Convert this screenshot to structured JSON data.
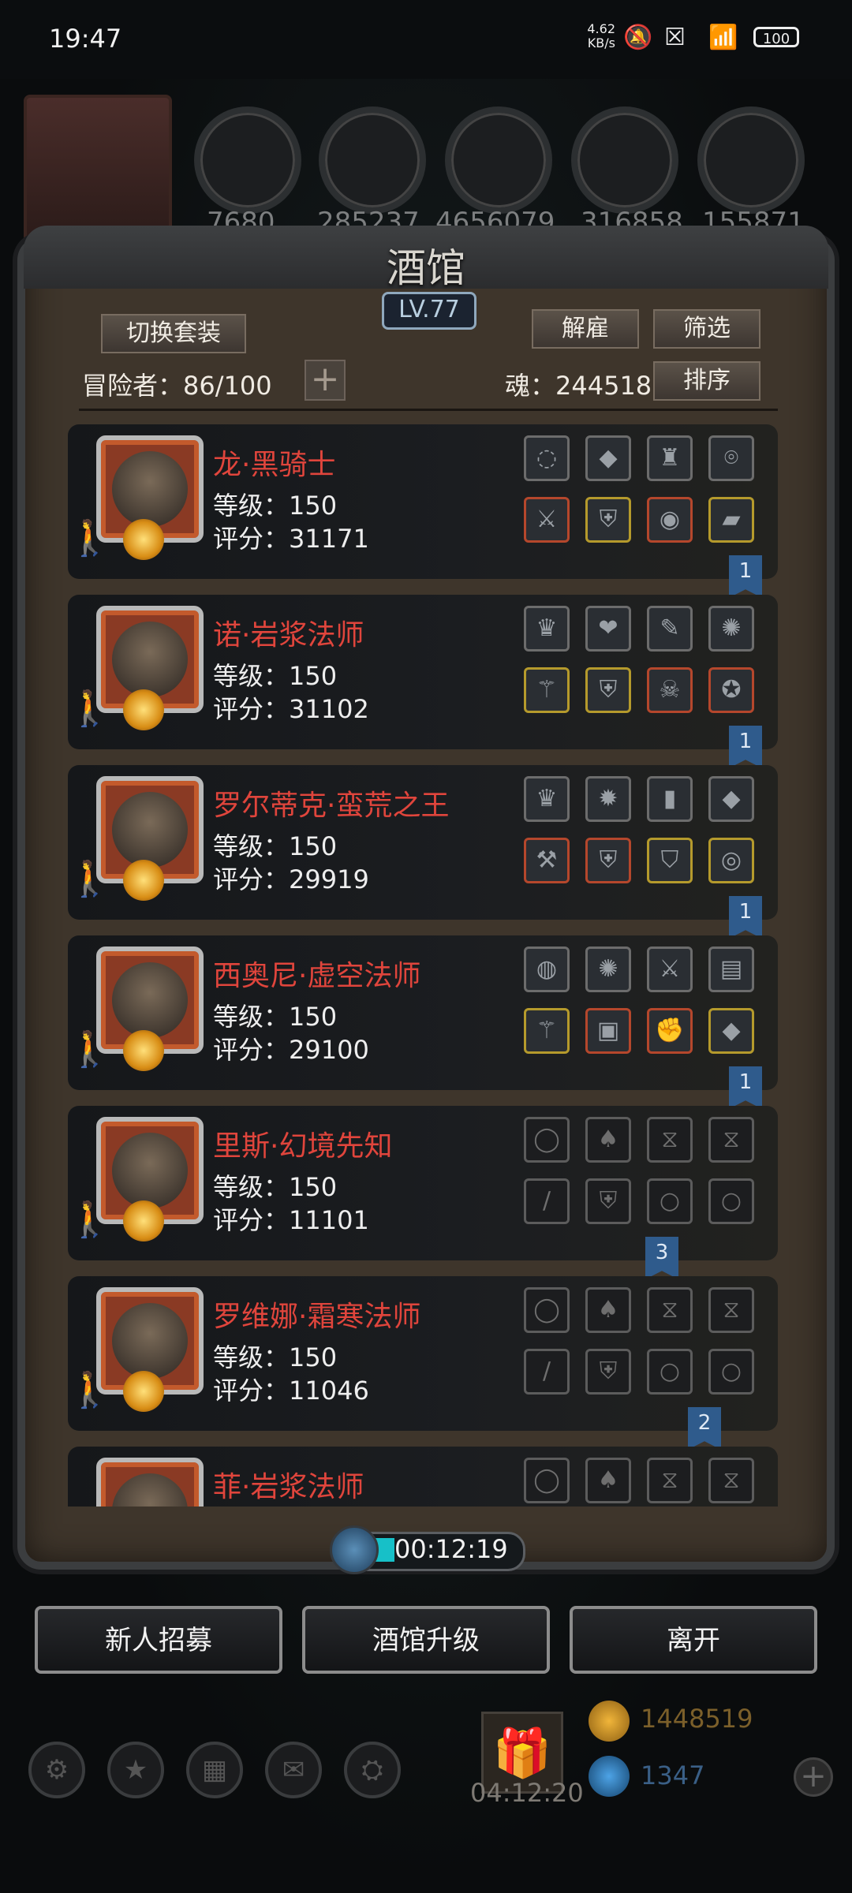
{
  "status_bar": {
    "time": "19:47",
    "net_speed": "4.62\nKB/s",
    "battery": "100"
  },
  "resources": [
    "7680",
    "285237",
    "4656079",
    "316858",
    "155871"
  ],
  "tavern": {
    "title": "酒馆",
    "level": "LV.77",
    "switch_outfit": "切换套装",
    "fire": "解雇",
    "filter": "筛选",
    "sort": "排序",
    "adventurers": "冒险者：86/100",
    "soul": "魂：244518"
  },
  "heroes": [
    {
      "name": "龙·黑骑士",
      "level": "等级：150",
      "score": "评分：31171",
      "flag": "1"
    },
    {
      "name": "诺·岩浆法师",
      "level": "等级：150",
      "score": "评分：31102",
      "flag": "1"
    },
    {
      "name": "罗尔蒂克·蛮荒之王",
      "level": "等级：150",
      "score": "评分：29919",
      "flag": "1"
    },
    {
      "name": "西奥尼·虚空法师",
      "level": "等级：150",
      "score": "评分：29100",
      "flag": "1"
    },
    {
      "name": "里斯·幻境先知",
      "level": "等级：150",
      "score": "评分：11101",
      "flag": "3"
    },
    {
      "name": "罗维娜·霜寒法师",
      "level": "等级：150",
      "score": "评分：11046",
      "flag": "2"
    },
    {
      "name": "菲·岩浆法师",
      "level": "",
      "score": "",
      "flag": ""
    }
  ],
  "timer": "00:12:19",
  "bottom_buttons": {
    "recruit": "新人招募",
    "upgrade": "酒馆升级",
    "leave": "离开"
  },
  "gift_timer": "04:12:20",
  "gold": "1448519",
  "gems": "1347",
  "colors": {
    "hero_name": "#e0453c",
    "panel": "#3e352b",
    "timer_fill": "#17c0c8"
  }
}
